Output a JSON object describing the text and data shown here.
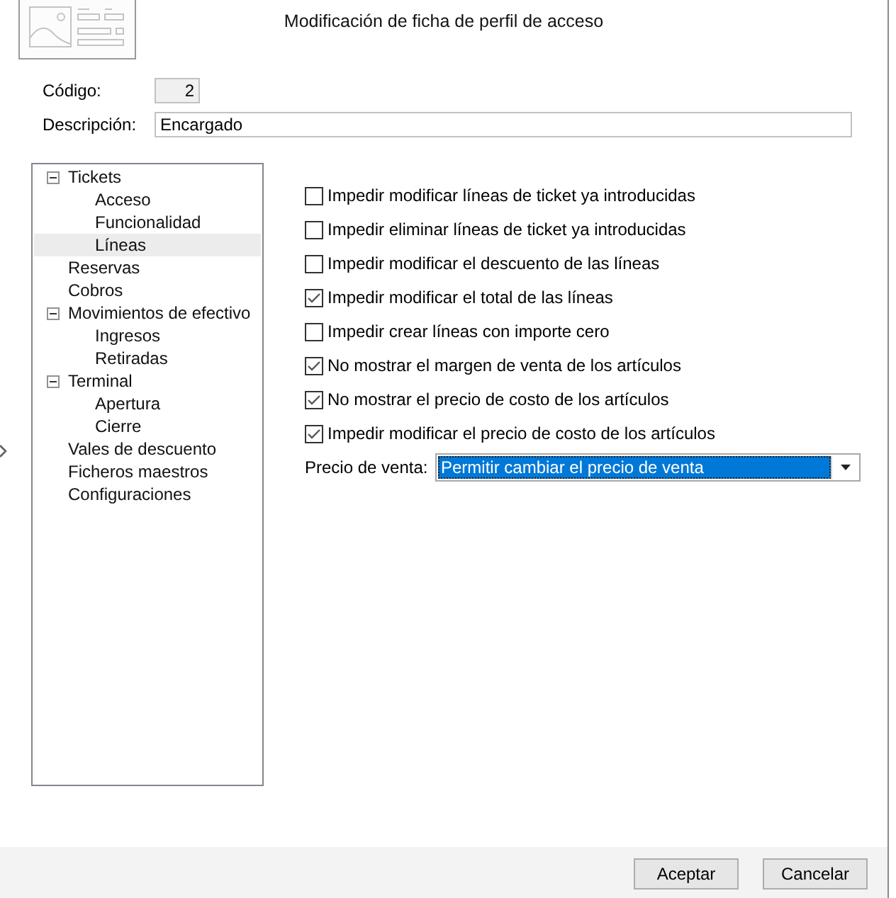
{
  "header": {
    "title": "Modificación de ficha de perfil de acceso"
  },
  "fields": [
    {
      "kind": "readonly",
      "label": "Código:",
      "value": "2"
    },
    {
      "kind": "text",
      "label": "Descripción:",
      "value": "Encargado"
    }
  ],
  "tree": {
    "items": [
      {
        "label": "Tickets",
        "expanded": true,
        "selected": false,
        "children": [
          {
            "label": "Acceso",
            "selected": false
          },
          {
            "label": "Funcionalidad",
            "selected": false
          },
          {
            "label": "Líneas",
            "selected": true
          }
        ]
      },
      {
        "label": "Reservas",
        "selected": false
      },
      {
        "label": "Cobros",
        "selected": false
      },
      {
        "label": "Movimientos de efectivo",
        "expanded": true,
        "selected": false,
        "children": [
          {
            "label": "Ingresos",
            "selected": false
          },
          {
            "label": "Retiradas",
            "selected": false
          }
        ]
      },
      {
        "label": "Terminal",
        "expanded": true,
        "selected": false,
        "children": [
          {
            "label": "Apertura",
            "selected": false
          },
          {
            "label": "Cierre",
            "selected": false
          }
        ]
      },
      {
        "label": "Vales de descuento",
        "selected": false
      },
      {
        "label": "Ficheros maestros",
        "selected": false
      },
      {
        "label": "Configuraciones",
        "selected": false
      }
    ]
  },
  "options": [
    {
      "label": "Impedir modificar líneas de ticket ya introducidas",
      "checked": false
    },
    {
      "label": "Impedir eliminar líneas de ticket ya introducidas",
      "checked": false
    },
    {
      "label": "Impedir modificar el descuento de las líneas",
      "checked": false
    },
    {
      "label": "Impedir modificar el total de las líneas",
      "checked": true
    },
    {
      "label": "Impedir crear líneas con importe cero",
      "checked": false
    },
    {
      "label": "No mostrar el margen de venta de los artículos",
      "checked": true
    },
    {
      "label": "No mostrar el precio de costo de los artículos",
      "checked": true
    },
    {
      "label": "Impedir modificar el precio de costo de los artículos",
      "checked": true
    }
  ],
  "sale_price": {
    "label": "Precio de venta:",
    "value": "Permitir cambiar el precio de venta"
  },
  "buttons": [
    {
      "label": "Aceptar"
    },
    {
      "label": "Cancelar"
    }
  ]
}
